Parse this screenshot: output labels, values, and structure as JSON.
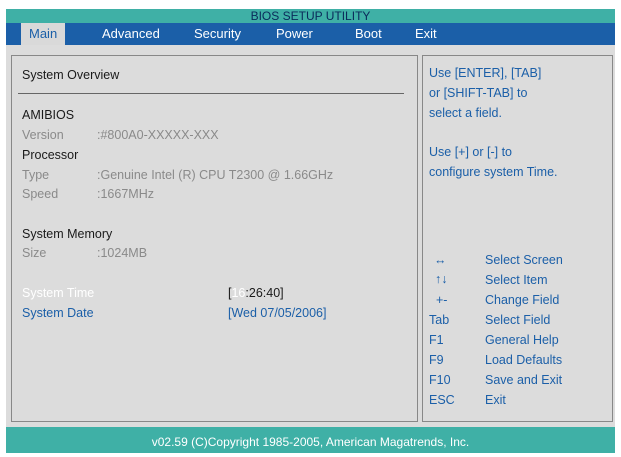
{
  "title": "BIOS SETUP UTILITY",
  "menu": [
    "Main",
    "Advanced",
    "Security",
    "Power",
    "Boot",
    "Exit"
  ],
  "left": {
    "overview": "System Overview",
    "amibios": "AMIBIOS",
    "version_label": "Version",
    "version_value": ":#800A0-XXXXX-XXX",
    "processor": "Processor",
    "type_label": "Type",
    "type_value": ":Genuine Intel (R)  CPU T2300  @ 1.66GHz",
    "speed_label": "Speed",
    "speed_value": ":1667MHz",
    "memory": "System Memory",
    "size_label": "Size",
    "size_value": ":1024MB",
    "time_label": "System Time",
    "time_bracket_open": "[",
    "time_hour": "16",
    "time_rest": ":26:40]",
    "date_label": "System Date",
    "date_value": "[Wed 07/05/2006]"
  },
  "right": {
    "help1": "Use [ENTER], [TAB]",
    "help2": "or [SHIFT-TAB] to",
    "help3": "select a field.",
    "help4": "Use [+] or [-] to",
    "help5": "configure system Time.",
    "keys": [
      {
        "key": "↔",
        "desc": "Select  Screen"
      },
      {
        "key": "↑↓",
        "desc": "Select  Item"
      },
      {
        "key": "+-",
        "desc": "Change Field"
      },
      {
        "key": "Tab",
        "desc": "Select Field"
      },
      {
        "key": "F1",
        "desc": "General Help"
      },
      {
        "key": "F9",
        "desc": "Load Defaults"
      },
      {
        "key": "F10",
        "desc": "Save and Exit"
      },
      {
        "key": "ESC",
        "desc": "Exit"
      }
    ]
  },
  "footer": "v02.59 (C)Copyright 1985-2005, American Magatrends, Inc."
}
